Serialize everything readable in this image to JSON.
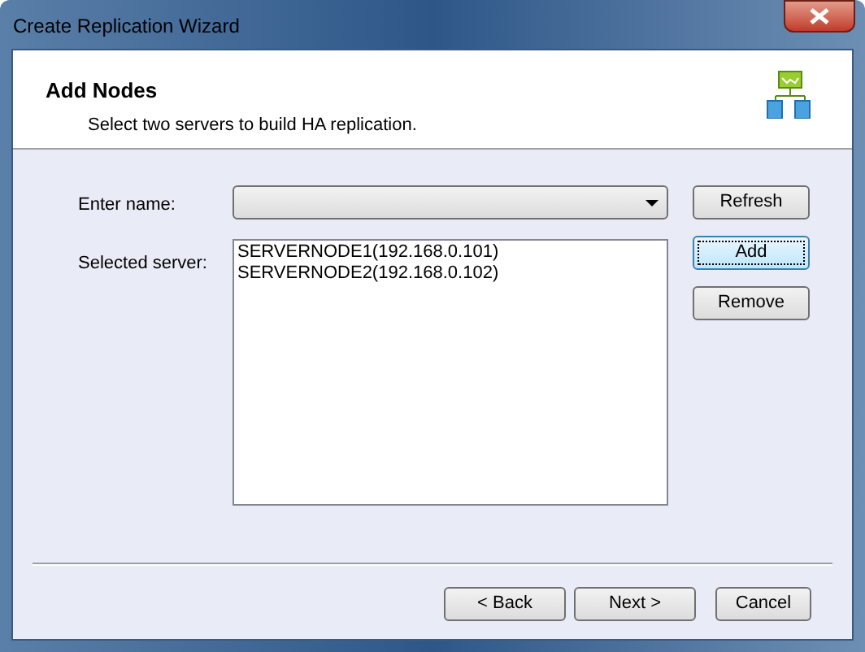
{
  "window": {
    "title": "Create Replication Wizard"
  },
  "header": {
    "title": "Add Nodes",
    "subtitle": "Select two servers to build HA replication."
  },
  "form": {
    "name_label": "Enter name:",
    "server_label": "Selected server:",
    "servers": [
      "SERVERNODE1(192.168.0.101)",
      "SERVERNODE2(192.168.0.102)"
    ],
    "side_buttons": [
      {
        "label": "Refresh",
        "focused": false
      },
      {
        "label": "Add",
        "focused": true
      },
      {
        "label": "Remove",
        "focused": false
      }
    ]
  },
  "footer_buttons": [
    {
      "label": "< Back",
      "kind": "nav"
    },
    {
      "label": "Next >",
      "kind": "nav"
    },
    {
      "label": "Cancel",
      "kind": "cancel"
    }
  ]
}
